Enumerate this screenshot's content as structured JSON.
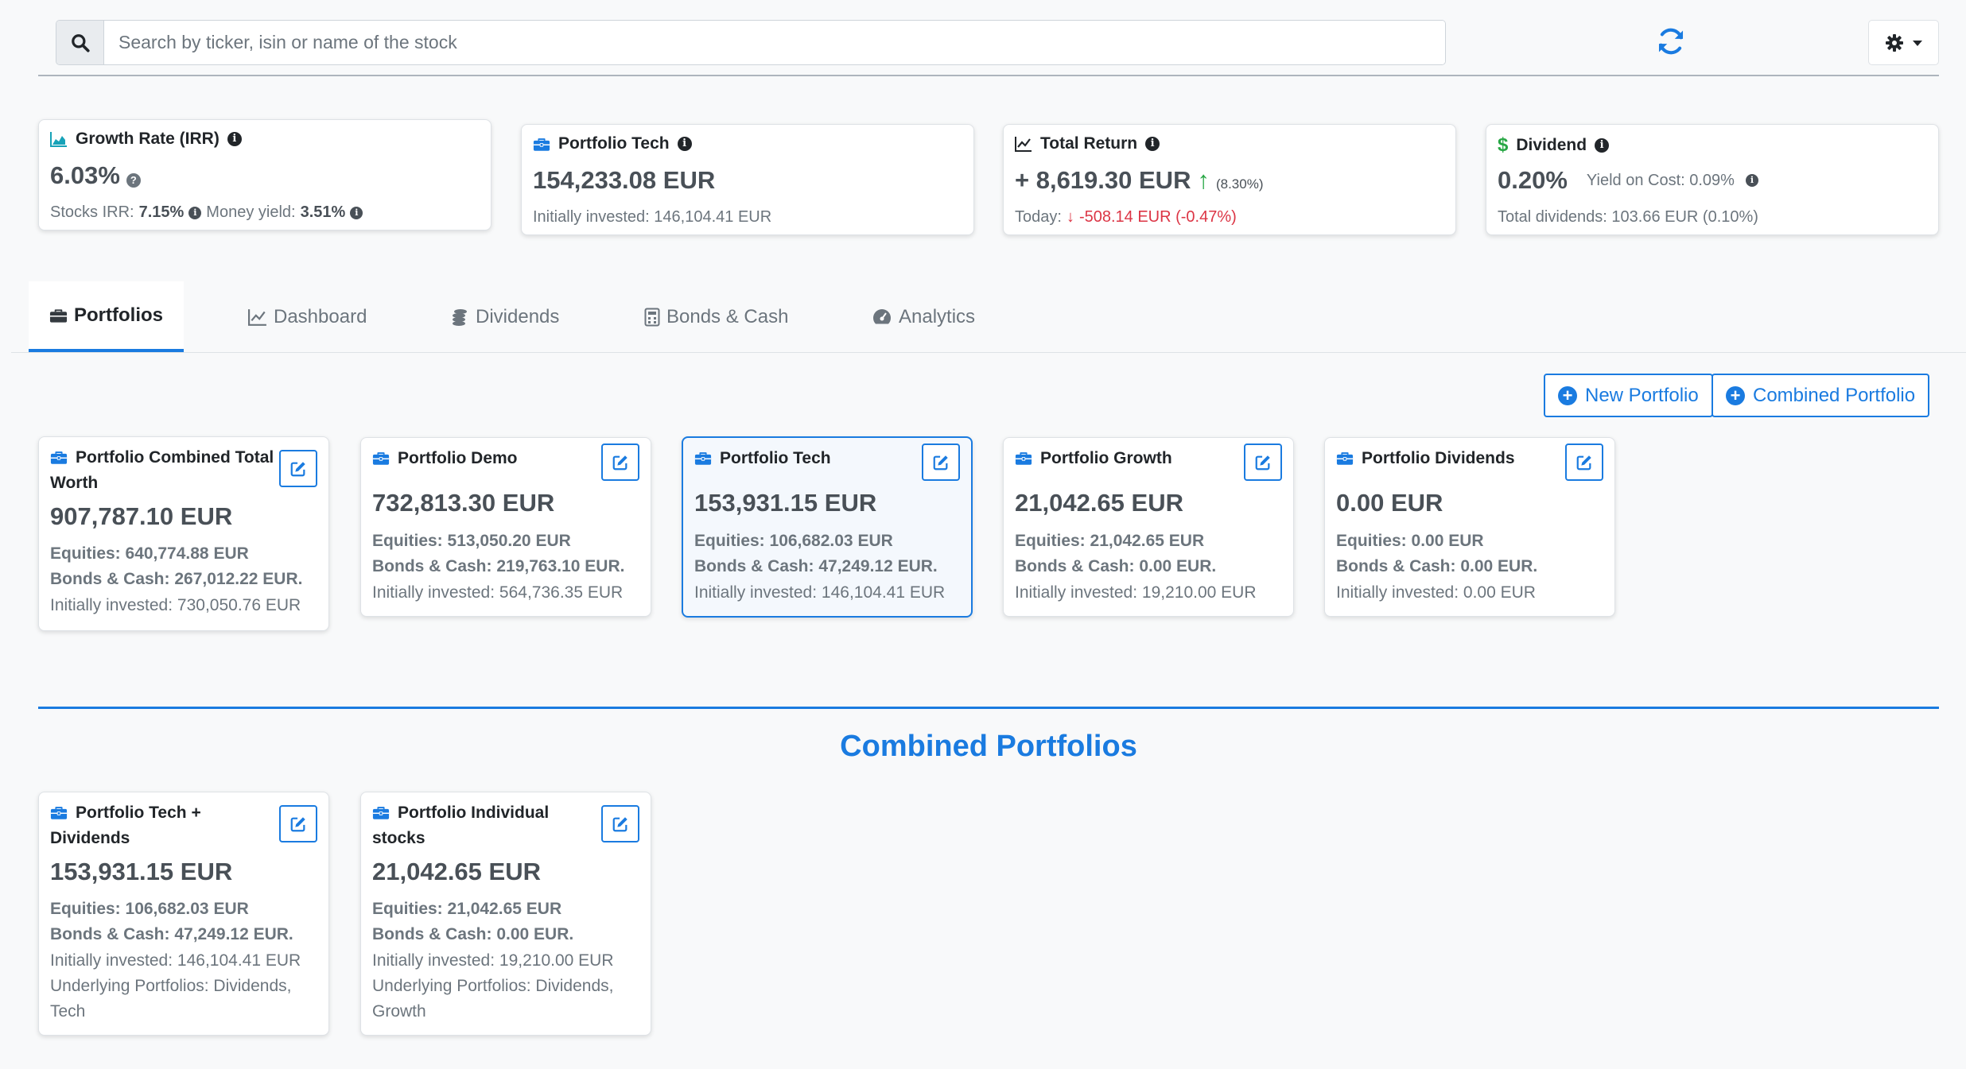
{
  "search": {
    "placeholder": "Search by ticker, isin or name of the stock"
  },
  "icons": {
    "search": "search-icon",
    "refresh": "refresh-icon",
    "settings": "gear-icon",
    "briefcase": "briefcase-icon",
    "edit": "edit-icon",
    "chart_area": "area-chart-icon",
    "chart_line": "line-chart-icon",
    "dollar": "dollar-icon",
    "coins": "coins-icon",
    "calculator": "calculator-icon",
    "gauge": "gauge-icon",
    "info": "info-icon",
    "plus": "plus-circle-icon"
  },
  "colors": {
    "accent": "#1a7be0",
    "teal": "#17a2b8",
    "positive": "#28a745",
    "negative": "#dc3545",
    "dividend": "#28a745"
  },
  "summary": {
    "growth": {
      "title": "Growth Rate (IRR)",
      "value": "6.03%",
      "stocks_irr_label": "Stocks IRR:",
      "stocks_irr": "7.15%",
      "money_yield_label": "Money yield:",
      "money_yield": "3.51%"
    },
    "portfolio": {
      "title": "Portfolio Tech",
      "value": "154,233.08 EUR",
      "sub": "Initially invested: 146,104.41 EUR"
    },
    "total_return": {
      "title": "Total Return",
      "value": "+ 8,619.30 EUR",
      "arrow": "↑",
      "pct": "(8.30%)",
      "today_label": "Today:",
      "today_arrow": "↓",
      "today_value": "-508.14 EUR (-0.47%)"
    },
    "dividend": {
      "title": "Dividend",
      "value": "0.20%",
      "yoc": "Yield on Cost: 0.09%",
      "sub": "Total dividends: 103.66 EUR (0.10%)"
    }
  },
  "tabs": [
    {
      "label": "Portfolios",
      "icon": "briefcase-icon",
      "active": true
    },
    {
      "label": "Dashboard",
      "icon": "line-chart-icon",
      "active": false
    },
    {
      "label": "Dividends",
      "icon": "coins-icon",
      "active": false
    },
    {
      "label": "Bonds & Cash",
      "icon": "calculator-icon",
      "active": false
    },
    {
      "label": "Analytics",
      "icon": "gauge-icon",
      "active": false
    }
  ],
  "actions": {
    "new_portfolio": "New Portfolio",
    "combined_portfolio": "Combined Portfolio"
  },
  "portfolios": [
    {
      "name": "Portfolio Combined Total Worth",
      "total": "907,787.10 EUR",
      "equities": "Equities: 640,774.88 EUR",
      "bonds": "Bonds & Cash: 267,012.22 EUR.",
      "initially": "Initially invested: 730,050.76 EUR",
      "selected": false
    },
    {
      "name": "Portfolio Demo",
      "total": "732,813.30 EUR",
      "equities": "Equities: 513,050.20 EUR",
      "bonds": "Bonds & Cash: 219,763.10 EUR.",
      "initially": "Initially invested: 564,736.35 EUR",
      "selected": false
    },
    {
      "name": "Portfolio Tech",
      "total": "153,931.15 EUR",
      "equities": "Equities: 106,682.03 EUR",
      "bonds": "Bonds & Cash: 47,249.12 EUR.",
      "initially": "Initially invested: 146,104.41 EUR",
      "selected": true
    },
    {
      "name": "Portfolio Growth",
      "total": "21,042.65 EUR",
      "equities": "Equities: 21,042.65 EUR",
      "bonds": "Bonds & Cash: 0.00 EUR.",
      "initially": "Initially invested: 19,210.00 EUR",
      "selected": false
    },
    {
      "name": "Portfolio Dividends",
      "total": "0.00 EUR",
      "equities": "Equities: 0.00 EUR",
      "bonds": "Bonds & Cash: 0.00 EUR.",
      "initially": "Initially invested: 0.00 EUR",
      "selected": false
    }
  ],
  "combined_heading": "Combined Portfolios",
  "combined": [
    {
      "name": "Portfolio Tech + Dividends",
      "total": "153,931.15 EUR",
      "equities": "Equities: 106,682.03 EUR",
      "bonds": "Bonds & Cash: 47,249.12 EUR.",
      "initially": "Initially invested: 146,104.41 EUR",
      "underlying": "Underlying Portfolios: Dividends, Tech"
    },
    {
      "name": "Portfolio Individual stocks",
      "total": "21,042.65 EUR",
      "equities": "Equities: 21,042.65 EUR",
      "bonds": "Bonds & Cash: 0.00 EUR.",
      "initially": "Initially invested: 19,210.00 EUR",
      "underlying": "Underlying Portfolios: Dividends, Growth"
    }
  ]
}
